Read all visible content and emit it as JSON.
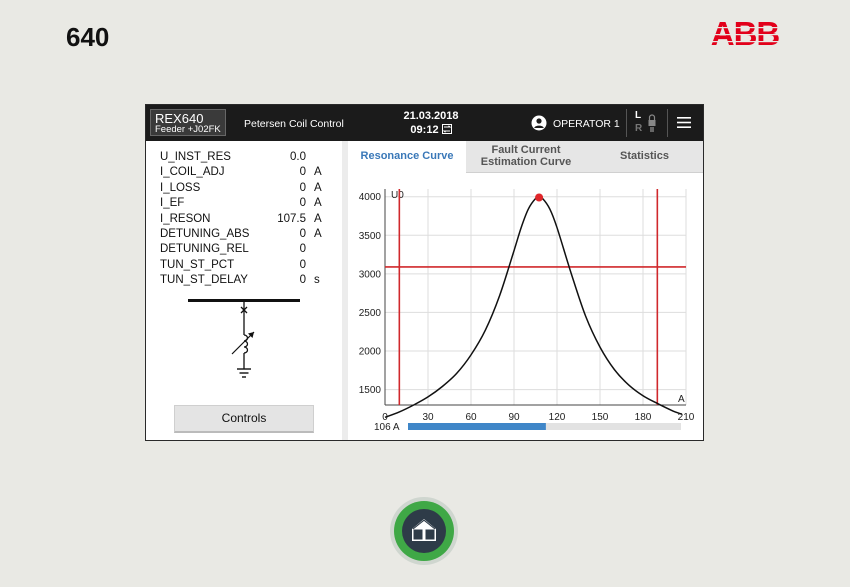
{
  "page": {
    "model_label": "640"
  },
  "brand": {
    "logo_text": "ABB",
    "color": "#e2001a"
  },
  "topbar": {
    "device_name": "REX640",
    "feeder": "Feeder +J02FK",
    "app_title": "Petersen Coil Control",
    "date": "21.03.2018",
    "time": "09:12",
    "user": "OPERATOR 1",
    "local_label": "L",
    "remote_label": "R"
  },
  "values": [
    {
      "label": "U_INST_RES",
      "value": "0.0",
      "unit": ""
    },
    {
      "label": "I_COIL_ADJ",
      "value": "0",
      "unit": "A"
    },
    {
      "label": "I_LOSS",
      "value": "0",
      "unit": "A"
    },
    {
      "label": "I_EF",
      "value": "0",
      "unit": "A"
    },
    {
      "label": "I_RESON",
      "value": "107.5",
      "unit": "A"
    },
    {
      "label": "DETUNING_ABS",
      "value": "0",
      "unit": "A"
    },
    {
      "label": "DETUNING_REL",
      "value": "0",
      "unit": ""
    },
    {
      "label": "TUN_ST_PCT",
      "value": "0",
      "unit": ""
    },
    {
      "label": "TUN_ST_DELAY",
      "value": "0",
      "unit": "s"
    }
  ],
  "controls_button": "Controls",
  "tabs": [
    {
      "label_lines": [
        "Resonance Curve"
      ],
      "active": true
    },
    {
      "label_lines": [
        "Fault Current",
        "Estimation Curve"
      ],
      "active": false
    },
    {
      "label_lines": [
        "Statistics"
      ],
      "active": false
    }
  ],
  "chart_data": {
    "type": "line",
    "ylabel": "U0",
    "xlabel": "A",
    "xlim": [
      0,
      210
    ],
    "ylim": [
      1300,
      4100
    ],
    "x_ticks": [
      0,
      30,
      60,
      90,
      120,
      150,
      180,
      210
    ],
    "y_ticks": [
      1500,
      2000,
      2500,
      3000,
      3500,
      4000
    ],
    "grid": true,
    "series": [
      {
        "x": [
          0,
          10,
          20,
          30,
          40,
          50,
          60,
          70,
          80,
          90,
          95,
          100,
          105,
          107.5,
          110,
          115,
          120,
          130,
          140,
          150,
          160,
          170,
          180,
          190,
          200,
          207
        ],
        "y": [
          1140,
          1210,
          1300,
          1405,
          1540,
          1710,
          1950,
          2270,
          2720,
          3300,
          3600,
          3840,
          3975,
          3990,
          3975,
          3840,
          3600,
          3000,
          2450,
          2050,
          1760,
          1560,
          1420,
          1320,
          1230,
          1180
        ]
      }
    ],
    "peak": {
      "x": 107.5,
      "y": 3990
    },
    "vertical_lines": [
      10,
      190
    ],
    "horizontal_line": 3090,
    "progress": {
      "label": "106 A",
      "fraction": 0.505
    },
    "colors": {
      "curve": "#111111",
      "marker": "#e0262a",
      "limit_lines": "#d0282c",
      "progress_fill": "#3f86c8",
      "progress_track": "#e2e2e2",
      "grid": "#dddddd"
    }
  },
  "home_button": {
    "icon": "home-icon",
    "ring_color": "#3fa846",
    "core_color": "#2e3b48"
  }
}
